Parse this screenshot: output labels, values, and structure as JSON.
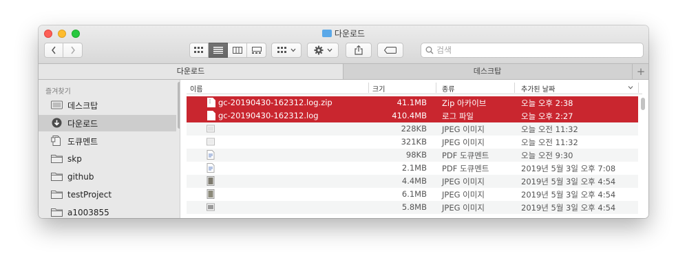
{
  "window": {
    "title": "다운로드"
  },
  "toolbar": {
    "view_modes": [
      "icon-view",
      "list-view",
      "column-view",
      "gallery-view"
    ],
    "active_view": "list-view",
    "group_menu": "group-menu",
    "action_menu": "action-menu",
    "share": "share",
    "tags": "tags"
  },
  "search": {
    "placeholder": "검색"
  },
  "tabs": [
    {
      "label": "다운로드",
      "active": true
    },
    {
      "label": "데스크탑",
      "active": false
    }
  ],
  "sidebar": {
    "heading": "즐겨찾기",
    "items": [
      {
        "label": "데스크탑",
        "icon": "desktop-icon",
        "selected": false
      },
      {
        "label": "다운로드",
        "icon": "download-icon",
        "selected": true
      },
      {
        "label": "도큐멘트",
        "icon": "document-icon",
        "selected": false
      },
      {
        "label": "skp",
        "icon": "folder-icon",
        "selected": false
      },
      {
        "label": "github",
        "icon": "folder-icon",
        "selected": false
      },
      {
        "label": "testProject",
        "icon": "folder-icon",
        "selected": false
      },
      {
        "label": "a1003855",
        "icon": "folder-icon",
        "selected": false
      }
    ]
  },
  "columns": {
    "name": "이름",
    "size": "크기",
    "kind": "종류",
    "date": "추가된 날짜"
  },
  "files": [
    {
      "name": "gc-20190430-162312.log.zip",
      "size": "41.1MB",
      "kind": "Zip 아카이브",
      "date": "오늘 오후 2:38",
      "selected": true
    },
    {
      "name": "gc-20190430-162312.log",
      "size": "410.4MB",
      "kind": "로그 파일",
      "date": "오늘 오후 2:27",
      "selected": true
    },
    {
      "name": "",
      "size": "228KB",
      "kind": "JPEG 이미지",
      "date": "오늘 오전 11:32",
      "selected": false
    },
    {
      "name": "",
      "size": "321KB",
      "kind": "JPEG 이미지",
      "date": "오늘 오전 11:32",
      "selected": false
    },
    {
      "name": "",
      "size": "98KB",
      "kind": "PDF 도큐멘트",
      "date": "오늘 오전 9:30",
      "selected": false
    },
    {
      "name": "",
      "size": "2.1MB",
      "kind": "PDF 도큐멘트",
      "date": "2019년 5월 3일 오후 7:08",
      "selected": false
    },
    {
      "name": "",
      "size": "4.4MB",
      "kind": "JPEG 이미지",
      "date": "2019년 5월 3일 오후 4:54",
      "selected": false
    },
    {
      "name": "",
      "size": "6.1MB",
      "kind": "JPEG 이미지",
      "date": "2019년 5월 3일 오후 4:54",
      "selected": false
    },
    {
      "name": "",
      "size": "5.8MB",
      "kind": "JPEG 이미지",
      "date": "2019년 5월 3일 오후 4:54",
      "selected": false
    }
  ]
}
